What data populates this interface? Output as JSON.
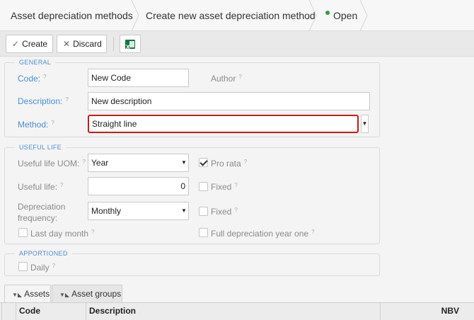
{
  "breadcrumb": {
    "items": [
      "Asset depreciation methods",
      "Create new asset depreciation method"
    ],
    "status": "Open"
  },
  "toolbar": {
    "create_label": "Create",
    "discard_label": "Discard"
  },
  "general": {
    "legend": "GENERAL",
    "code_label": "Code:",
    "code_value": "New Code",
    "author_label": "Author",
    "description_label": "Description:",
    "description_value": "New description",
    "method_label": "Method:",
    "method_value": "Straight line"
  },
  "useful_life": {
    "legend": "USEFUL LIFE",
    "uom_label": "Useful life UOM:",
    "uom_value": "Year",
    "pro_rata_label": "Pro rata",
    "pro_rata_checked": true,
    "life_label": "Useful life:",
    "life_value": "0",
    "fixed_label": "Fixed",
    "fixed1_checked": false,
    "freq_label_1": "Depreciation",
    "freq_label_2": "frequency:",
    "freq_value": "Monthly",
    "fixed2_checked": false,
    "last_day_label": "Last day month",
    "last_day_checked": false,
    "full_year_label": "Full depreciation year one",
    "full_year_checked": false
  },
  "apportioned": {
    "legend": "APPORTIONED",
    "daily_label": "Daily",
    "daily_checked": false
  },
  "tabs": [
    {
      "label": "Assets",
      "active": true
    },
    {
      "label": "Asset groups",
      "active": false
    }
  ],
  "grid": {
    "columns": [
      "Code",
      "Description",
      "NBV"
    ]
  },
  "colors": {
    "accent": "#4a8fd4",
    "focus_border": "#c41c1c",
    "status_dot": "#2e9e45"
  },
  "icons": [
    "check-icon",
    "close-icon",
    "excel-icon",
    "help-icon",
    "chevron-down-icon",
    "tab-icon"
  ]
}
